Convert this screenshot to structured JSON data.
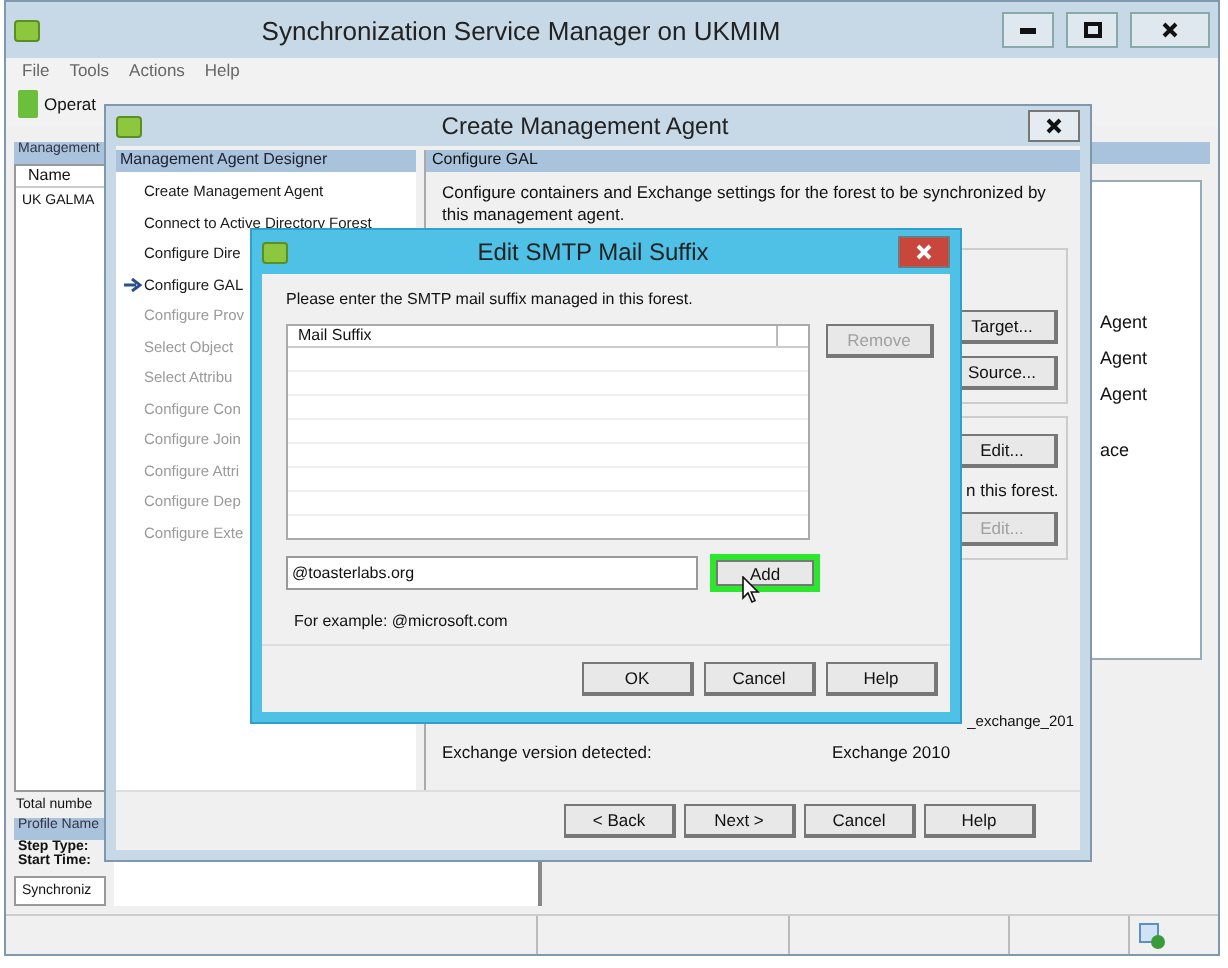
{
  "main_window": {
    "title": "Synchronization Service Manager on UKMIM",
    "menu": [
      "File",
      "Tools",
      "Actions",
      "Help"
    ],
    "toolbar": [
      "Operat"
    ],
    "left_panel": {
      "header": "Management",
      "column": "Name",
      "rows": [
        "UK GALMA"
      ],
      "total": "Total numbe",
      "profile_header": "Profile Name",
      "fields": [
        "Step Type:",
        "Start Time:"
      ],
      "list_item": "Synchroniz"
    },
    "right_panel": {
      "rows": [
        "Agent",
        "Agent",
        "Agent",
        "ace"
      ]
    }
  },
  "designer_dialog": {
    "title": "Create Management Agent",
    "steps_header": "Management Agent Designer",
    "steps": [
      {
        "label": "Create Management Agent",
        "current": false,
        "disabled": false
      },
      {
        "label": "Connect to Active Directory Forest",
        "current": false,
        "disabled": false
      },
      {
        "label": "Configure Dire",
        "current": false,
        "disabled": false
      },
      {
        "label": "Configure GAL",
        "current": true,
        "disabled": false
      },
      {
        "label": "Configure Prov",
        "current": false,
        "disabled": true
      },
      {
        "label": "Select Object",
        "current": false,
        "disabled": true
      },
      {
        "label": "Select Attribu",
        "current": false,
        "disabled": true
      },
      {
        "label": "Configure Con",
        "current": false,
        "disabled": true
      },
      {
        "label": "Configure Join",
        "current": false,
        "disabled": true
      },
      {
        "label": "Configure Attri",
        "current": false,
        "disabled": true
      },
      {
        "label": "Configure Dep",
        "current": false,
        "disabled": true
      },
      {
        "label": "Configure Exte",
        "current": false,
        "disabled": true
      }
    ],
    "page_header": "Configure GAL",
    "description": "Configure containers and Exchange settings for the forest to be synchronized by this management agent.",
    "group_buttons": [
      {
        "label": "Target...",
        "disabled": false
      },
      {
        "label": "Source...",
        "disabled": false
      }
    ],
    "suffix_button": {
      "label": "Edit...",
      "disabled": false
    },
    "note": "n this forest.",
    "second_button": {
      "label": "Edit...",
      "disabled": true
    },
    "partial_value": "_exchange_201",
    "version_label": "Exchange version detected:",
    "version_value": "Exchange 2010",
    "nav_buttons": [
      "< Back",
      "Next >",
      "Cancel",
      "Help"
    ]
  },
  "smtp_dialog": {
    "title": "Edit SMTP Mail Suffix",
    "prompt": "Please enter the SMTP mail suffix managed in this forest.",
    "list_column": "Mail Suffix",
    "remove_button": {
      "label": "Remove",
      "disabled": true
    },
    "input_value": "@toasterlabs.org",
    "add_button": {
      "label": "Add",
      "highlighted": true
    },
    "example": "For example: @microsoft.com",
    "buttons": [
      "OK",
      "Cancel",
      "Help"
    ]
  }
}
